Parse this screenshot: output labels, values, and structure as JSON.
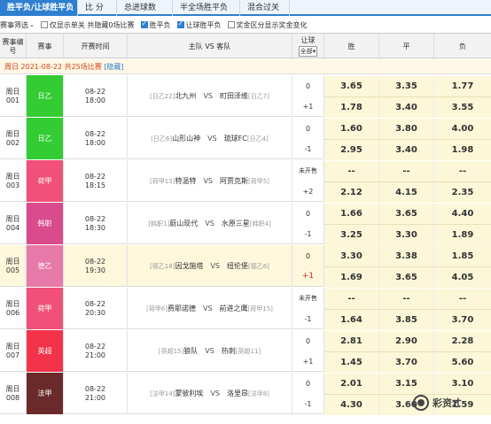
{
  "tabs": [
    "胜平负/让球胜平负",
    "比 分",
    "总进球数",
    "半全场胜平负",
    "混合过关"
  ],
  "filters": [
    {
      "label": "赛事筛选",
      "checked": null
    },
    {
      "label": "仅显示单关 共隐藏0场比赛",
      "checked": false
    },
    {
      "label": "胜平负",
      "checked": true
    },
    {
      "label": "让球胜平负",
      "checked": true
    },
    {
      "label": "奖金区分显示奖金变化",
      "checked": false
    }
  ],
  "header": {
    "num": "赛事编号",
    "league": "赛事",
    "time": "开赛时间",
    "teams": "主队 VS 客队",
    "handicap": "让球",
    "handicap_select": "全部",
    "win": "胜",
    "draw": "平",
    "lose": "负"
  },
  "daybar": {
    "text": "周日 2021-08-22  共25场比赛",
    "hide": "[隐藏]"
  },
  "colors": {
    "tab_accent": "#2f7fd0",
    "odds_bg": "#fbf7d8",
    "red": "#e02020"
  },
  "matches": [
    {
      "num": "周日001",
      "league": "日乙",
      "league_color": "#33cc33",
      "date": "08-22",
      "time": "18:00",
      "home_rank": "[日乙22]",
      "home": "北九州",
      "vs": "VS",
      "away": "町田泽维",
      "away_rank": "[日乙7]",
      "h1": "0",
      "h2": "+1",
      "o1": [
        "3.65",
        "3.35",
        "1.77"
      ],
      "o2": [
        "1.78",
        "3.40",
        "3.55"
      ]
    },
    {
      "num": "周日002",
      "league": "日乙",
      "league_color": "#33cc33",
      "date": "08-22",
      "time": "18:00",
      "home_rank": "[日乙6]",
      "home": "山形山神",
      "vs": "VS",
      "away": "琉球FC",
      "away_rank": "[日乙4]",
      "h1": "0",
      "h2": "-1",
      "o1": [
        "1.60",
        "3.80",
        "4.00"
      ],
      "o2": [
        "2.95",
        "3.40",
        "1.98"
      ]
    },
    {
      "num": "周日003",
      "league": "荷甲",
      "league_color": "#f0507a",
      "date": "08-22",
      "time": "18:15",
      "home_rank": "[荷甲13]",
      "home": "特温特",
      "vs": "VS",
      "away": "阿贾克斯",
      "away_rank": "[荷甲5]",
      "h1": "未开售",
      "h2": "+2",
      "o1": [
        "--",
        "--",
        "--"
      ],
      "o2": [
        "2.12",
        "4.15",
        "2.35"
      ]
    },
    {
      "num": "周日004",
      "league": "韩职",
      "league_color": "#d94b8c",
      "date": "08-22",
      "time": "18:30",
      "home_rank": "[韩职1]",
      "home": "蔚山现代",
      "vs": "VS",
      "away": "水原三星",
      "away_rank": "[韩职4]",
      "h1": "0",
      "h2": "-1",
      "o1": [
        "1.66",
        "3.65",
        "4.40"
      ],
      "o2": [
        "3.25",
        "3.30",
        "1.89"
      ]
    },
    {
      "num": "周日005",
      "league": "德乙",
      "league_color": "#e779a8",
      "date": "08-22",
      "time": "19:30",
      "home_rank": "[德乙18]",
      "home": "因戈施塔",
      "vs": "VS",
      "away": "纽伦堡",
      "away_rank": "[德乙6]",
      "h1": "0",
      "h2": "+1",
      "o1": [
        "3.30",
        "3.38",
        "1.85"
      ],
      "o2": [
        "1.69",
        "3.65",
        "4.05"
      ],
      "highlight": true
    },
    {
      "num": "周日006",
      "league": "荷甲",
      "league_color": "#f0507a",
      "date": "08-22",
      "time": "20:30",
      "home_rank": "[荷甲6]",
      "home": "费耶诺德",
      "vs": "VS",
      "away": "前进之鹰",
      "away_rank": "[荷甲15]",
      "h1": "未开售",
      "h2": "-1",
      "o1": [
        "--",
        "--",
        "--"
      ],
      "o2": [
        "1.64",
        "3.85",
        "3.70"
      ]
    },
    {
      "num": "周日007",
      "league": "英超",
      "league_color": "#f2334a",
      "date": "08-22",
      "time": "21:00",
      "home_rank": "[英超15]",
      "home": "狼队",
      "vs": "VS",
      "away": "热刺",
      "away_rank": "[英超11]",
      "h1": "0",
      "h2": "+1",
      "o1": [
        "2.81",
        "2.90",
        "2.28"
      ],
      "o2": [
        "1.45",
        "3.70",
        "5.60"
      ]
    },
    {
      "num": "周日008",
      "league": "法甲",
      "league_color": "#6b2a2a",
      "date": "08-22",
      "time": "21:00",
      "home_rank": "[法甲14]",
      "home": "蒙彼利埃",
      "vs": "VS",
      "away": "洛里昂",
      "away_rank": "[法甲8]",
      "h1": "0",
      "h2": "-1",
      "o1": [
        "2.01",
        "3.15",
        "3.10"
      ],
      "o2": [
        "4.30",
        "3.60",
        "1.59"
      ]
    }
  ],
  "watermark": {
    "icon": "wechat-icon",
    "text": "彩资才"
  }
}
